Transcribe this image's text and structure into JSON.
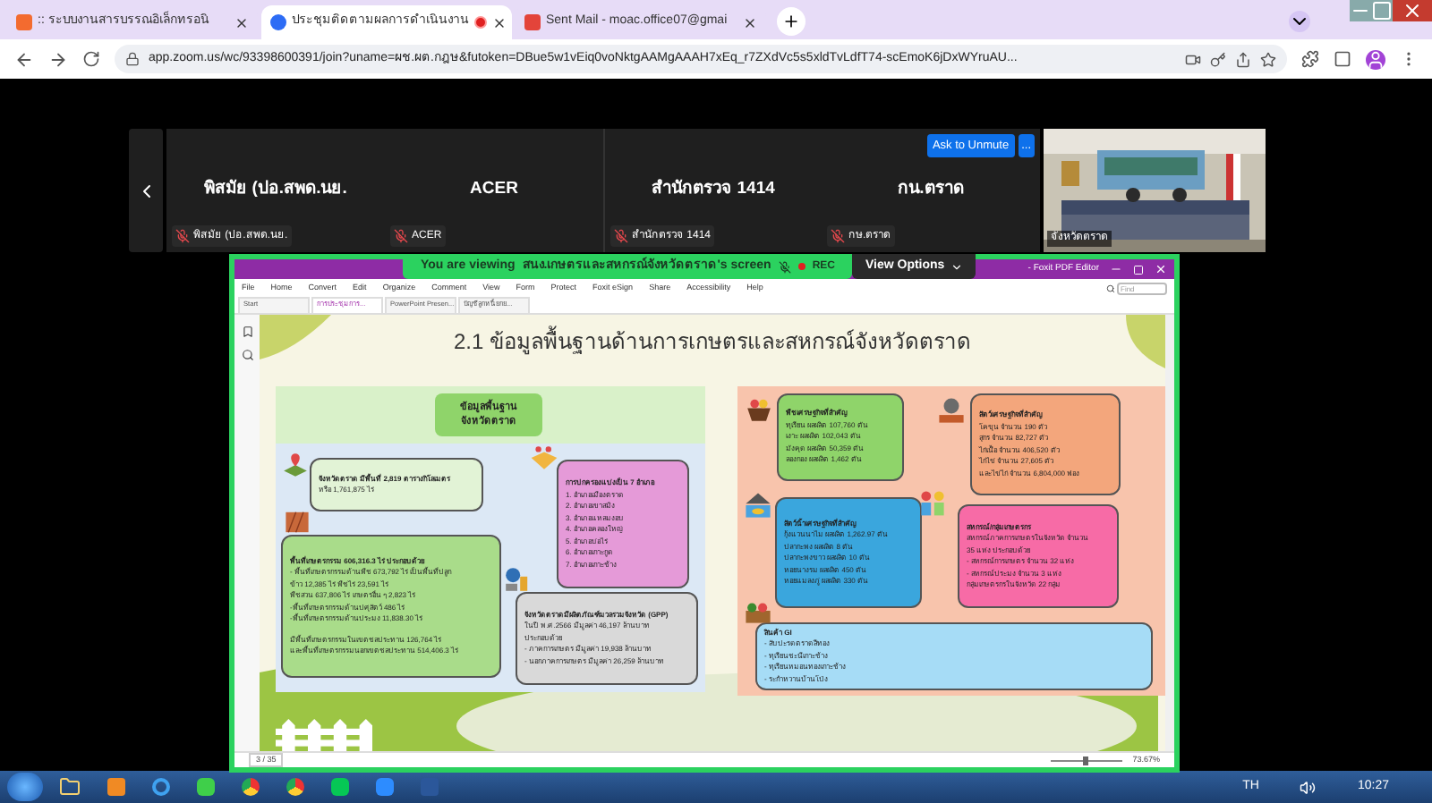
{
  "browser": {
    "tabs": [
      {
        "title": ":: ระบบงานสารบรรณอิเล็กทรอนิ",
        "selected": false,
        "recording": false
      },
      {
        "title": "ประชุมติดตามผลการดำเนินงาน",
        "selected": true,
        "recording": true
      },
      {
        "title": "Sent Mail - moac.office07@gmai",
        "selected": false,
        "recording": false
      }
    ],
    "url": "app.zoom.us/wc/93398600391/join?uname=ผช.ผต.กฎษ&futoken=DBue5w1vEiq0voNktgAAMgAAAH7xEq_r7ZXdVc5s5xldTvLdfT74-scEmoK6jDxWYruAU..."
  },
  "meeting": {
    "participants": [
      {
        "name": "พิสมัย (ปอ.สพด.นย.",
        "label": "พิสมัย (ปอ.สพด.นย.",
        "muted": true
      },
      {
        "name": "ACER",
        "label": "ACER",
        "muted": true
      },
      {
        "name": "สำนักตรวจ 1414",
        "label": "สำนักตรวจ 1414",
        "muted": true
      },
      {
        "name": "กน.ตราด",
        "label": "กษ.ตราด",
        "muted": true
      }
    ],
    "ask_button": "Ask to Unmute",
    "more_button": "...",
    "video_label": "จังหวัดตราด",
    "banner": {
      "prefix": "You are viewing",
      "sharer": "สนง.เกษตรและสหกรณ์จังหวัดตราด's screen",
      "rec": "REC"
    },
    "view_options": "View Options"
  },
  "pdf_app": {
    "title": "- Foxit PDF Editor",
    "menu": [
      "File",
      "Home",
      "Convert",
      "Edit",
      "Organize",
      "Comment",
      "View",
      "Form",
      "Protect",
      "Foxit eSign",
      "Share",
      "Accessibility",
      "Help"
    ],
    "find_placeholder": "Find",
    "doc_tabs": [
      {
        "label": "Start",
        "selected": false
      },
      {
        "label": "การประชุมการ...",
        "selected": true
      },
      {
        "label": "PowerPoint Presen...",
        "selected": false
      },
      {
        "label": "บัญชีลูกหนี้ยกย...",
        "selected": false
      }
    ],
    "page": "3 / 35",
    "zoom": "73.67%"
  },
  "slide": {
    "title": "2.1 ข้อมูลพื้นฐานด้านการเกษตรและสหกรณ์จังหวัดตราด",
    "left_header": [
      "ข้อมูลพื้นฐาน",
      "จังหวัดตราด"
    ],
    "left_cards": [
      {
        "color": "#e2f3d6",
        "lines": [
          "จังหวัดตราด มีพื้นที่ 2,819 ตารางกิโลเมตร",
          "หรือ 1,761,875 ไร่"
        ]
      },
      {
        "color": "#a9dc8a",
        "lines": [
          "พื้นที่เกษตรกรรม 606,316.3 ไร่ ประกอบด้วย",
          "- พื้นที่เกษตรกรรมด้านพืช 673,792 ไร่ เป็นพื้นที่ปลูก",
          "ข้าว 12,385 ไร่ พืชไร่ 23,591 ไร่",
          "พืชสวน 637,806 ไร่ เกษตรอื่น ๆ 2,823 ไร่",
          "-พื้นที่เกษตรกรรมด้านปศุสัตว์ 486 ไร่",
          "-พื้นที่เกษตรกรรมด้านประมง 11,838.30 ไร่",
          "มีพื้นที่เกษตรกรรมในเขตชลประทาน 126,764 ไร่",
          "และพื้นที่เกษตรกรรมนอกเขตชลประทาน 514,406.3 ไร่"
        ]
      },
      {
        "color": "#e59ad8",
        "lines": [
          "การปกครองแบ่งเป็น 7 อำเภอ",
          "1. อำเภอเมืองตราด",
          "2. อำเภอเขาสมิง",
          "3. อำเภอแหลมงอบ",
          "4. อำเภอคลองใหญ่",
          "5. อำเภอบ่อไร่",
          "6. อำเภอเกาะกูด",
          "7. อำเภอเกาะช้าง"
        ]
      },
      {
        "color": "#d9d9d9",
        "lines": [
          "จังหวัดตราดมีผลิตภัณฑ์มวลรวมจังหวัด (GPP)",
          "ในปี พ.ศ.2566 มีมูลค่า 46,197 ล้านบาท",
          "ประกอบด้วย",
          "- ภาคการเกษตร มีมูลค่า 19,938 ล้านบาท",
          "- นอกภาคการเกษตร มีมูลค่า 26,259 ล้านบาท"
        ]
      }
    ],
    "right_cards": [
      {
        "color": "#8fd46a",
        "lines": [
          "พืชเศรษฐกิจที่สำคัญ",
          "ทุเรียน ผลผลิต 107,760 ตัน",
          "เงาะ ผลผลิต 102,043 ตัน",
          "มังคุด ผลผลิต 50,359 ตัน",
          "ลองกอง ผลผลิต 1,462 ตัน"
        ]
      },
      {
        "color": "#f3a67c",
        "lines": [
          "สัตว์เศรษฐกิจที่สำคัญ",
          "โคขุน จำนวน 190 ตัว",
          "สุกร จำนวน 82,727 ตัว",
          "ไก่เนื้อ จำนวน 406,520 ตัว",
          "ไก่ไข่ จำนวน 27,605 ตัว",
          "และไข่ไก่ จำนวน 6,804,000 ฟอง"
        ]
      },
      {
        "color": "#3aa6dd",
        "lines": [
          "สัตว์น้ำเศรษฐกิจที่สำคัญ",
          "กุ้งแวนนาไม ผลผลิต 1,262.97 ตัน",
          "ปลากะพง ผลผลิต 8 ตัน",
          "ปลากะพงขาว ผลผลิต 10 ตัน",
          "หอยนางรม ผลผลิต 450 ตัน",
          "หอยแมลงภู่ ผลผลิต 330 ตัน"
        ]
      },
      {
        "color": "#f76ba6",
        "lines": [
          "สหกรณ์/กลุ่มเกษตรกร",
          "สหกรณ์ภาคการเกษตรในจังหวัด จำนวน",
          "35 แห่ง ประกอบด้วย",
          "- สหกรณ์การเกษตร จำนวน 32 แห่ง",
          "- สหกรณ์ประมง จำนวน 3 แห่ง",
          "กลุ่มเกษตรกรในจังหวัด 22 กลุ่ม"
        ]
      },
      {
        "color": "#a6dcf6",
        "lines": [
          "สินค้า GI",
          "- สับปะรดตราดสีทอง",
          "- ทุเรียนชะนีเกาะช้าง",
          "- ทุเรียนหมอนทองเกาะช้าง",
          "- ระกำหวานบ้านโป่ง"
        ]
      }
    ]
  },
  "taskbar": {
    "language": "TH",
    "time": "10:27"
  }
}
